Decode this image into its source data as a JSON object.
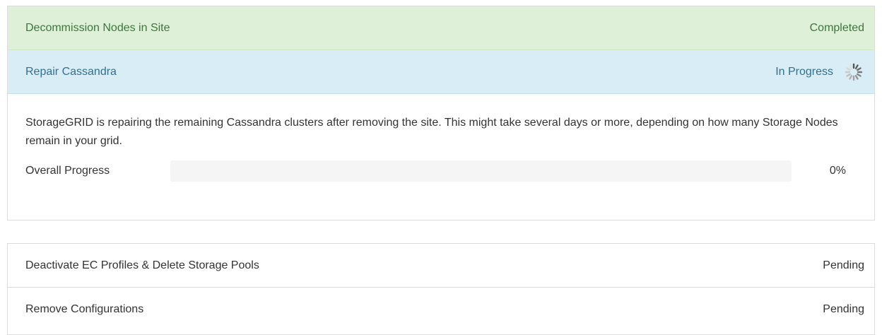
{
  "steps_top": {
    "decommission": {
      "name": "Decommission Nodes in Site",
      "status": "Completed"
    },
    "repair": {
      "name": "Repair Cassandra",
      "status": "In Progress",
      "spinner_icon": "loading-spinner-icon",
      "description": "StorageGRID is repairing the remaining Cassandra clusters after removing the site. This might take several days or more, depending on how many Storage Nodes remain in your grid.",
      "progress_label": "Overall Progress",
      "progress_text": "0%",
      "progress_fraction": 0
    }
  },
  "steps_bottom": {
    "deactivate": {
      "name": "Deactivate EC Profiles & Delete Storage Pools",
      "status": "Pending"
    },
    "remove": {
      "name": "Remove Configurations",
      "status": "Pending"
    }
  },
  "colors": {
    "completed_bg": "#dff0d8",
    "completed_text": "#3c763d",
    "inprogress_bg": "#d9edf7",
    "inprogress_text": "#31708f",
    "progress_track": "#f5f5f5",
    "progress_fill": "#428bca"
  }
}
